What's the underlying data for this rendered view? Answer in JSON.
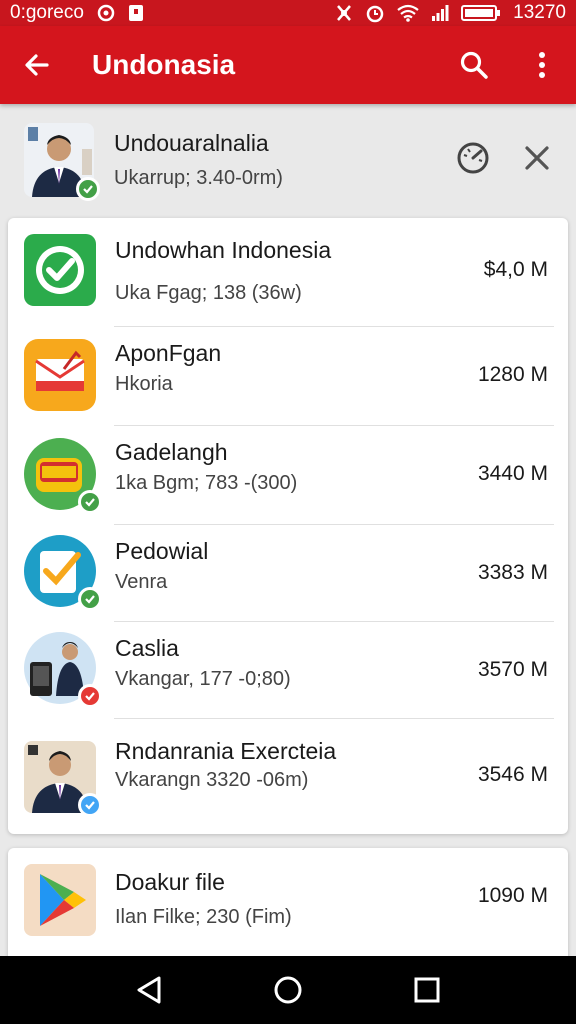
{
  "status_bar": {
    "carrier": "0:goreco",
    "time": "13270"
  },
  "app_bar": {
    "title": "Undonasia"
  },
  "profile": {
    "name": "Undouaralnalia",
    "subtitle": "Ukarrup; 3.40-0rm)"
  },
  "apps": [
    {
      "title": "Undowhan Indonesia",
      "subtitle": "Uka Fgag; 138 (36w)",
      "size": "$4,0 M"
    },
    {
      "title": "AponFgan",
      "subtitle": "Hkoria",
      "size": "1280 M"
    },
    {
      "title": "Gadelangh",
      "subtitle": "1ka Bgm; 783 -(300)",
      "size": "3440 M"
    },
    {
      "title": "Pedowial",
      "subtitle": "Venra",
      "size": "3383 M"
    },
    {
      "title": "Caslia",
      "subtitle": "Vkangar, 177 -0;80)",
      "size": "3570 M"
    },
    {
      "title": "Rndanrania Exercteia",
      "subtitle": "Vkarangn 3320 -06m)",
      "size": "3546 M"
    }
  ],
  "second_card": {
    "title": "Doakur file",
    "subtitle": "Ilan Filke; 230 (Fim)",
    "size": "1090 M"
  },
  "colors": {
    "primary": "#d4151d",
    "status_bar": "#c8161e",
    "badge_green": "#43a047",
    "badge_red": "#e53935",
    "badge_blue": "#42a5f5"
  }
}
